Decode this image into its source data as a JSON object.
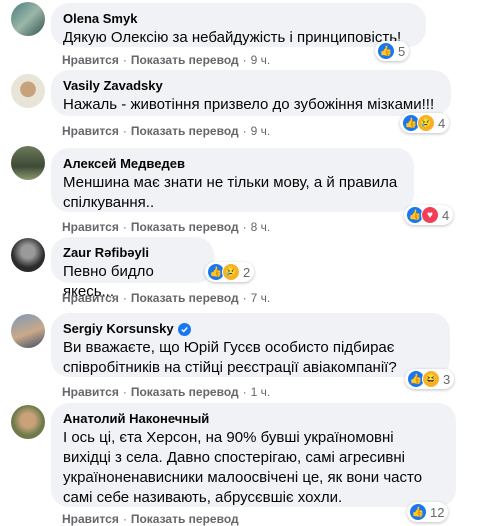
{
  "action_labels": {
    "like": "Нравится",
    "translate": "Показать перевод"
  },
  "comments": [
    {
      "author": "Olena Smyk",
      "text": "Дякую Олексію за небайдужість і принциповість!",
      "time": "9 ч.",
      "reaction_count": "5",
      "reactions": [
        "like"
      ]
    },
    {
      "author": "Vasily Zavadsky",
      "text": "Нажаль - животіння призвело до зубожіння мізками!!!",
      "time": "9 ч.",
      "reaction_count": "4",
      "reactions": [
        "like",
        "sad"
      ]
    },
    {
      "author": "Алексей Медведев",
      "text": "Меншина має знати не тільки мову, а й правила спілкування..",
      "time": "8 ч.",
      "reaction_count": "4",
      "reactions": [
        "like",
        "love"
      ]
    },
    {
      "author": "Zaur Rəfibəyli",
      "text": "Певно бидло якесь...",
      "time": "7 ч.",
      "reaction_count": "2",
      "reactions": [
        "like",
        "sad"
      ]
    },
    {
      "author": "Sergiy Korsunsky",
      "verified": true,
      "text": "Ви вважаєте, що Юрій Гусєв особисто підбирає співробітників на стійці реєстрації авіакомпанії?",
      "time": "1 ч.",
      "reaction_count": "3",
      "reactions": [
        "like",
        "haha"
      ]
    },
    {
      "author": "Анатолий Наконечный",
      "text": "І ось ці, єта Херсон, на 90% бувші україномовні вихідці з села. Давно спостерігаю, самі агресивні україноненависники малоосвічені це, як вони часто самі себе називають, абрусєвшіє хохли.",
      "time": "",
      "reaction_count": "12",
      "reactions": [
        "like"
      ]
    }
  ]
}
